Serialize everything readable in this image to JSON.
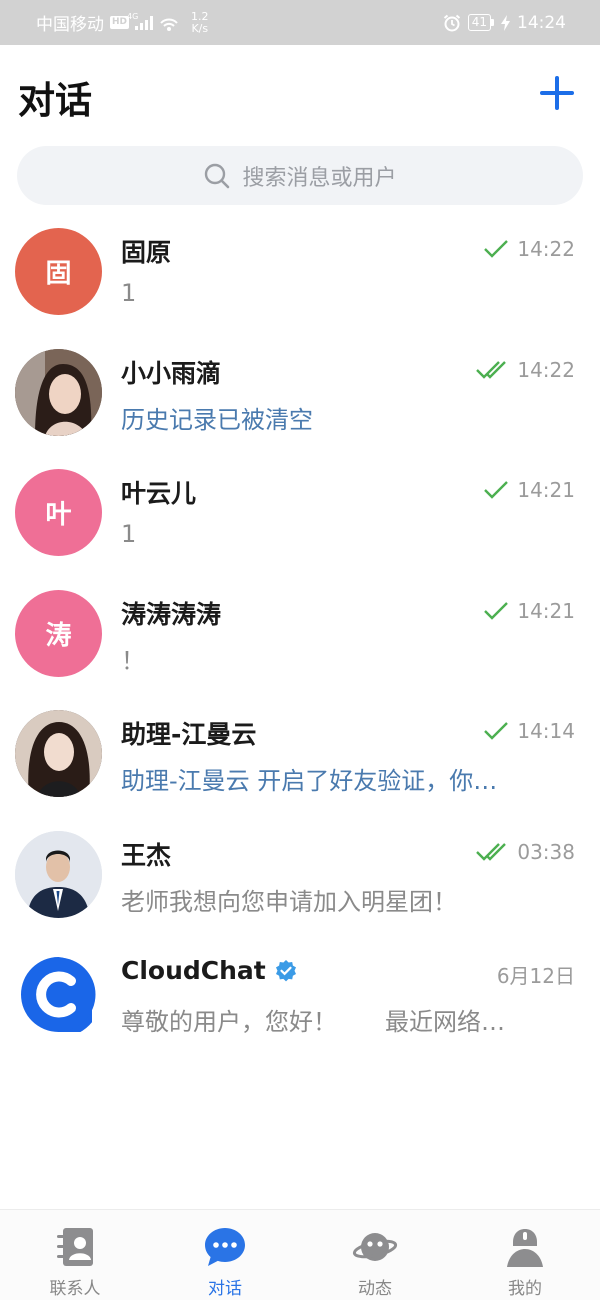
{
  "status_bar": {
    "carrier": "中国移动",
    "hd": "HD",
    "network": "4G",
    "speed_value": "1.2",
    "speed_unit": "K/s",
    "battery": "41",
    "time": "14:24"
  },
  "header": {
    "title": "对话",
    "new_icon": "plus-icon"
  },
  "search": {
    "placeholder": "搜索消息或用户",
    "icon": "search-icon"
  },
  "chats": [
    {
      "name": "固原",
      "avatar_text": "固",
      "avatar_color": "#e3644f",
      "preview": "1",
      "preview_style": "gray",
      "time": "14:22",
      "status": "sent"
    },
    {
      "name": "小小雨滴",
      "avatar_text": "",
      "avatar_color": "#6b5449",
      "preview": "历史记录已被清空",
      "preview_style": "blue",
      "time": "14:22",
      "status": "read"
    },
    {
      "name": "叶云儿",
      "avatar_text": "叶",
      "avatar_color": "#ef6f96",
      "preview": "1",
      "preview_style": "gray",
      "time": "14:21",
      "status": "sent"
    },
    {
      "name": "涛涛涛涛",
      "avatar_text": "涛",
      "avatar_color": "#ef6f96",
      "preview": "！",
      "preview_style": "gray",
      "time": "14:21",
      "status": "sent"
    },
    {
      "name": "助理-江曼云",
      "avatar_text": "",
      "avatar_color": "#3f3230",
      "preview": "助理-江曼云 开启了好友验证，你…",
      "preview_style": "blue",
      "time": "14:14",
      "status": "sent"
    },
    {
      "name": "王杰",
      "avatar_text": "",
      "avatar_color": "#dfe3ea",
      "preview": "老师我想向您申请加入明星团！",
      "preview_style": "gray",
      "time": "03:38",
      "status": "read"
    },
    {
      "name": "CloudChat",
      "avatar_text": "",
      "avatar_color": "#1a66e8",
      "preview": "尊敬的用户，您好！　　最近网络…",
      "preview_style": "gray",
      "time": "6月12日",
      "status": "none",
      "verified": true
    }
  ],
  "bottom_nav": [
    {
      "label": "联系人",
      "icon": "contacts-icon",
      "active": false
    },
    {
      "label": "对话",
      "icon": "chat-bubble-icon",
      "active": true
    },
    {
      "label": "动态",
      "icon": "planet-icon",
      "active": false
    },
    {
      "label": "我的",
      "icon": "profile-icon",
      "active": false
    }
  ],
  "colors": {
    "accent": "#1c6ee8",
    "check": "#4caf50",
    "preview_blue": "#4a7aae",
    "status_bar_bg": "#d2d2d2"
  }
}
